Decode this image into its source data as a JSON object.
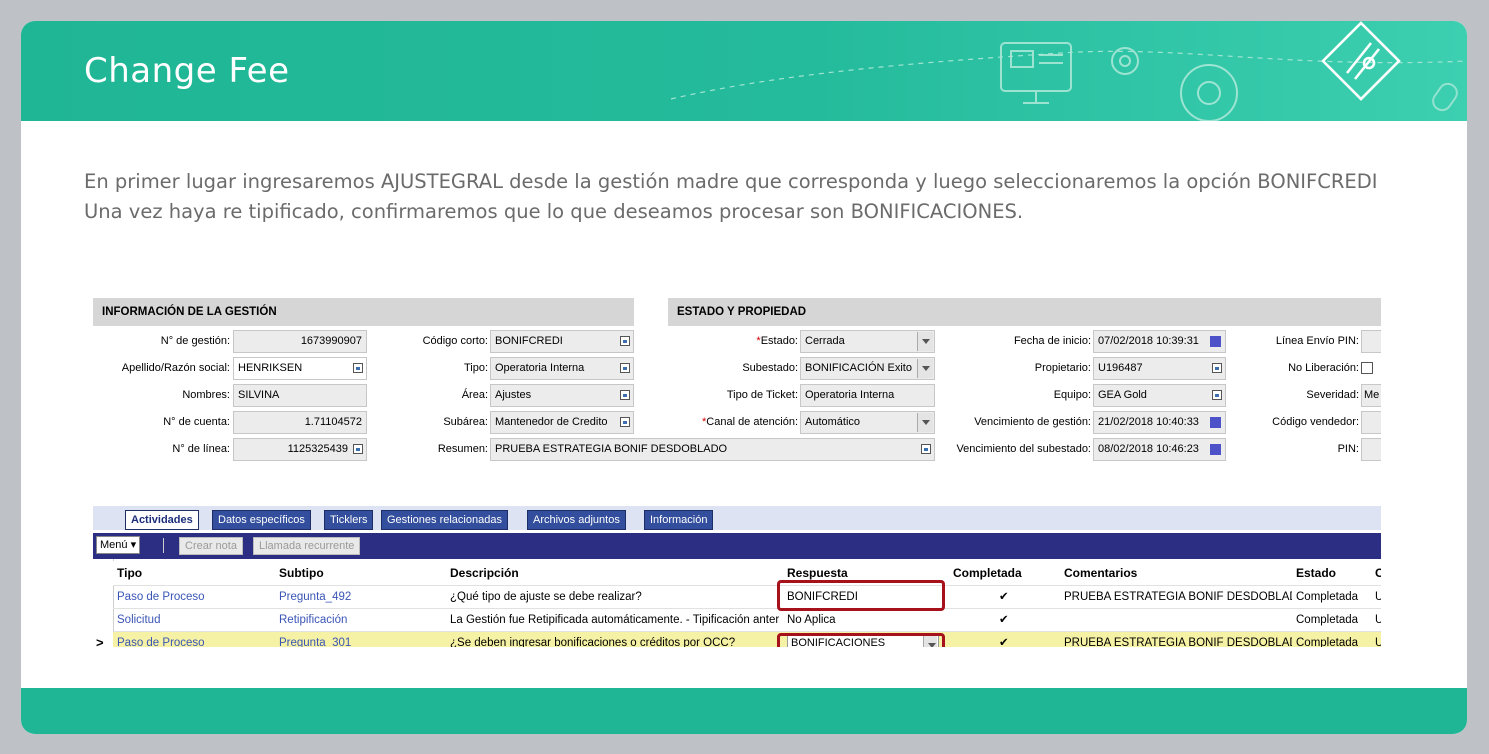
{
  "slide": {
    "title": "Change Fee",
    "intro": "En primer lugar ingresaremos AJUSTEGRAL desde la gestión madre que corresponda y luego seleccionaremos la opción BONIFCREDI Una vez haya re tipificado, confirmaremos que lo que deseamos procesar son BONIFICACIONES."
  },
  "colors": {
    "banner": "#1fb695",
    "highlight": "#a6111b",
    "selected_row": "#f6f2a5",
    "tab_bar": "#2b2e82"
  },
  "sections": {
    "info": "INFORMACIÓN DE LA GESTIÓN",
    "estado": "ESTADO Y PROPIEDAD"
  },
  "form": {
    "col1": [
      {
        "label": "N° de gestión:",
        "value": "1673990907"
      },
      {
        "label": "Apellido/Razón social:",
        "value": "HENRIKSEN"
      },
      {
        "label": "Nombres:",
        "value": "SILVINA"
      },
      {
        "label": "N° de cuenta:",
        "value": "1.71104572"
      },
      {
        "label": "N° de línea:",
        "value": "1125325439"
      }
    ],
    "col2": [
      {
        "label": "Código corto:",
        "value": "BONIFCREDI"
      },
      {
        "label": "Tipo:",
        "value": "Operatoria Interna"
      },
      {
        "label": "Área:",
        "value": "Ajustes"
      },
      {
        "label": "Subárea:",
        "value": "Mantenedor de Credito"
      },
      {
        "label": "Resumen:",
        "value": "PRUEBA ESTRATEGIA BONIF DESDOBLADO"
      }
    ],
    "col3": [
      {
        "label": "Estado:",
        "value": "Cerrada"
      },
      {
        "label": "Subestado:",
        "value": "BONIFICACIÓN Exito"
      },
      {
        "label": "Tipo de Ticket:",
        "value": "Operatoria Interna"
      },
      {
        "label": "Canal de atención:",
        "value": "Automático"
      }
    ],
    "col4": [
      {
        "label": "Fecha de inicio:",
        "value": "07/02/2018 10:39:31"
      },
      {
        "label": "Propietario:",
        "value": "U196487"
      },
      {
        "label": "Equipo:",
        "value": "GEA Gold"
      },
      {
        "label": "Vencimiento de gestión:",
        "value": "21/02/2018 10:40:33"
      },
      {
        "label": "Vencimiento del subestado:",
        "value": "08/02/2018 10:46:23"
      }
    ],
    "col5": [
      {
        "label": "Línea Envío PIN:",
        "value": ""
      },
      {
        "label": "No Liberación:",
        "value": ""
      },
      {
        "label": "Severidad:",
        "value": "Me"
      },
      {
        "label": "Código vendedor:",
        "value": ""
      },
      {
        "label": "PIN:",
        "value": ""
      }
    ]
  },
  "tabs": [
    "Actividades",
    "Datos específicos",
    "Ticklers",
    "Gestiones relacionadas",
    "Archivos adjuntos",
    "Información"
  ],
  "toolbar": {
    "menu": "Menú",
    "create_note": "Crear nota",
    "recurring_call": "Llamada recurrente"
  },
  "table": {
    "headers": [
      "Tipo",
      "Subtipo",
      "Descripción",
      "Respuesta",
      "Completada",
      "Comentarios",
      "Estado",
      "C"
    ],
    "rows": [
      {
        "tipo": "Paso de Proceso",
        "subtipo": "Pregunta_492",
        "descripcion": "¿Qué tipo de ajuste se debe realizar?",
        "respuesta": "BONIFCREDI",
        "completada": "✔",
        "comentarios": "PRUEBA ESTRATEGIA BONIF DESDOBLADO",
        "estado": "Completada",
        "c": "U"
      },
      {
        "tipo": "Solicitud",
        "subtipo": "Retipificación",
        "descripcion": "La Gestión fue Retipificada automáticamente. - Tipificación anterior",
        "respuesta": "No Aplica",
        "completada": "✔",
        "comentarios": "",
        "estado": "Completada",
        "c": "U"
      },
      {
        "tipo": "Paso de Proceso",
        "subtipo": "Pregunta_301",
        "descripcion": "¿Se deben ingresar bonificaciones o créditos por OCC?",
        "respuesta": "BONIFICACIONES",
        "completada": "✔",
        "comentarios": "PRUEBA ESTRATEGIA BONIF DESDOBLADO",
        "estado": "Completada",
        "c": "U"
      }
    ]
  }
}
